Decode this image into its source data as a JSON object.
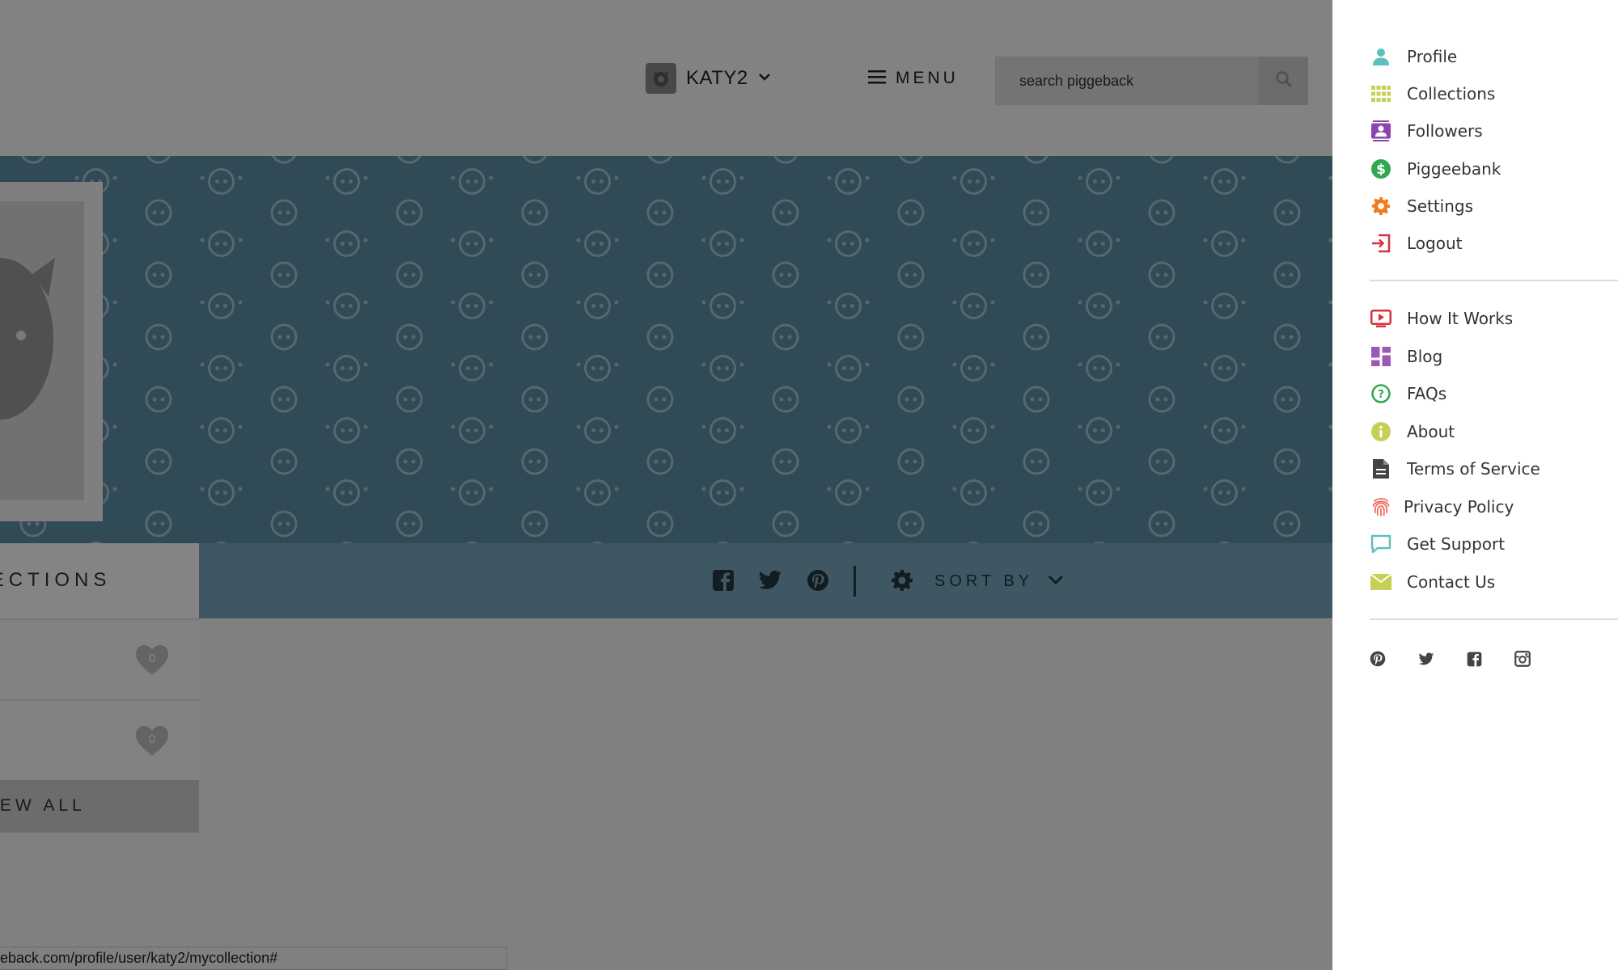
{
  "header": {
    "user_name": "KATY2",
    "menu_label": "MENU",
    "search_placeholder": "search piggeback"
  },
  "toolbar": {
    "sort_label": "SORT BY"
  },
  "collections": {
    "title": "COLLECTIONS",
    "items": [
      {
        "likes": "0"
      },
      {
        "likes": "0"
      }
    ],
    "view_all_label": "VIEW ALL"
  },
  "status_bar": {
    "url": "eback.com/profile/user/katy2/mycollection#"
  },
  "side_menu": {
    "account_items": [
      {
        "label": "Profile",
        "icon": "person-icon",
        "color": "#5bc0be"
      },
      {
        "label": "Collections",
        "icon": "grid-icon",
        "color": "#c6cf56"
      },
      {
        "label": "Followers",
        "icon": "contacts-icon",
        "color": "#8e44ad"
      },
      {
        "label": "Piggeebank",
        "icon": "dollar-icon",
        "color": "#2fa84f"
      },
      {
        "label": "Settings",
        "icon": "gear-icon",
        "color": "#f07b1e"
      },
      {
        "label": "Logout",
        "icon": "logout-icon",
        "color": "#d9303a"
      }
    ],
    "info_items": [
      {
        "label": "How It Works",
        "icon": "play-icon",
        "color": "#d9303a"
      },
      {
        "label": "Blog",
        "icon": "dashboard-icon",
        "color": "#9b59b6"
      },
      {
        "label": "FAQs",
        "icon": "help-icon",
        "color": "#2fa84f"
      },
      {
        "label": "About",
        "icon": "info-icon",
        "color": "#c6cf56"
      },
      {
        "label": "Terms of Service",
        "icon": "document-icon",
        "color": "#444444"
      },
      {
        "label": "Privacy Policy",
        "icon": "fingerprint-icon",
        "color": "#f06a5a"
      },
      {
        "label": "Get Support",
        "icon": "chat-icon",
        "color": "#5bc0be"
      },
      {
        "label": "Contact Us",
        "icon": "mail-icon",
        "color": "#c6cf56"
      }
    ],
    "social": [
      "pinterest-icon",
      "twitter-icon",
      "facebook-icon",
      "instagram-icon"
    ]
  }
}
